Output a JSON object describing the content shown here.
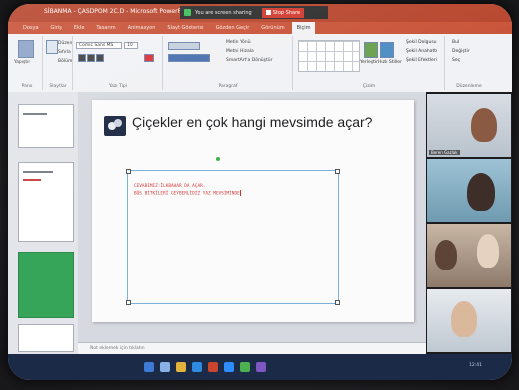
{
  "window": {
    "title": "SİBANMA - ÇASDPOM 2C.D - Microsoft PowerPoint"
  },
  "sharing_bar": {
    "status_text": "You are screen sharing",
    "stop_label": "Stop Share"
  },
  "ribbon": {
    "tabs": [
      "Dosya",
      "Giriş",
      "Ekle",
      "Tasarım",
      "Animasyon",
      "Slayt Gösterisi",
      "Gözden Geçir",
      "Görünüm",
      "Biçim"
    ],
    "active_tab_index": 8,
    "clipboard": {
      "paste": "Yapıştır",
      "cut": "Kes",
      "copy": "Kopyala",
      "group_label": "Pano"
    },
    "slides": {
      "new_slide": "Yeni Slayt",
      "layout": "Düzen",
      "reset": "Sıfırla",
      "section": "Bölüm",
      "group_label": "Slaytlar"
    },
    "font": {
      "font_name": "Comic Sans MS",
      "font_size": "10",
      "group_label": "Yazı Tipi"
    },
    "paragraph": {
      "text_direction": "Metin Yönü",
      "align_text": "Metni Hizala",
      "convert_smartart": "SmartArt'a Dönüştür",
      "group_label": "Paragraf"
    },
    "drawing": {
      "arrange": "Yerleştir",
      "quick_styles": "Hızlı Stiller",
      "shape_fill": "Şekil Dolgusu",
      "shape_outline": "Şekil Anahattı",
      "shape_effects": "Şekil Efektleri",
      "group_label": "Çizim"
    },
    "editing": {
      "find": "Bul",
      "replace": "Değiştir",
      "select": "Seç",
      "group_label": "Düzenleme"
    }
  },
  "slide": {
    "title": "Çiçekler en çok hangi mevsimde açar?",
    "answer_line1": "CEVABIMIZ:İLKBAHAR DA AÇAR.",
    "answer_line2": "BÜS BİTKİLERİ GEYBERLİDİZ YAZ MEVSİMİNDE"
  },
  "notes": {
    "placeholder": "Not eklemek için tıklatın"
  },
  "video_tiles": [
    "Beren Gazlak",
    "",
    "",
    ""
  ],
  "status_bar": {
    "clock": "12:41"
  },
  "colors": {
    "titlebar": "#b8472f",
    "answer_text": "#d43a3a",
    "green_thumbnail": "#36a55a",
    "share_indicator": "#3fbf5a",
    "stop_button": "#d33b2f"
  }
}
